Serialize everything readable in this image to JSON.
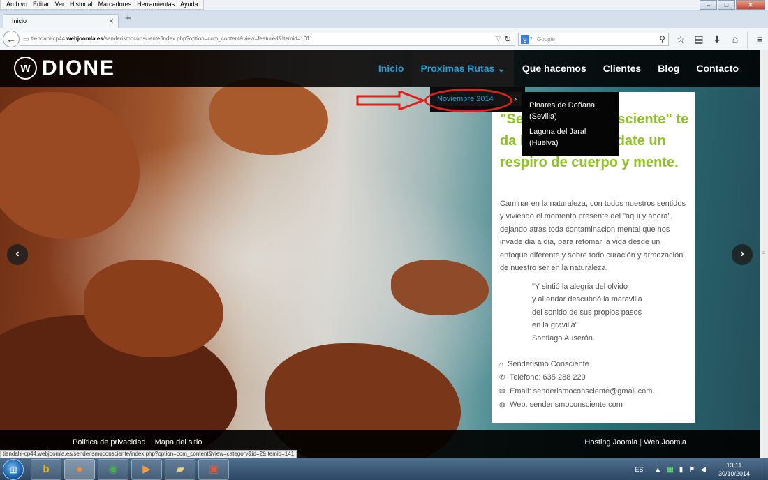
{
  "browser": {
    "menu": [
      "Archivo",
      "Editar",
      "Ver",
      "Historial",
      "Marcadores",
      "Herramientas",
      "Ayuda"
    ],
    "window_controls": {
      "minimize": "–",
      "maximize": "□",
      "close": "✕"
    },
    "tab": {
      "title": "Inicio",
      "close": "×"
    },
    "new_tab": "+",
    "url": {
      "prefix": "tiendahi-cp44.",
      "domain": "webjoomla.es",
      "path": "/senderismoconsciente/index.php?option=com_content&view=featured&Itemid=101"
    },
    "search": {
      "engine_badge": "g",
      "placeholder": "Google"
    },
    "status_url": "tiendahi-cp44.webjoomla.es/senderismoconsciente/index.php?option=com_content&view=category&id=2&Itemid=141"
  },
  "site": {
    "logo": {
      "mark": "w",
      "text": "DIONE"
    },
    "nav": [
      {
        "label": "Inicio"
      },
      {
        "label": "Proximas Rutas ⌄"
      },
      {
        "label": "Que hacemos"
      },
      {
        "label": "Clientes"
      },
      {
        "label": "Blog"
      },
      {
        "label": "Contacto"
      }
    ],
    "submenu": {
      "item": "Noviembre 2014",
      "caret": "›"
    },
    "subsubmenu": [
      {
        "line1": "Pinares de Doñana",
        "line2": "(Sevilla)"
      },
      {
        "line1": "Laguna del Jaral",
        "line2": "(Huelva)"
      }
    ],
    "panel": {
      "heading": "\"Senderismo Consciente\" te da la bienvenida, date un respiro de cuerpo y mente.",
      "intro": "Caminar en la naturaleza, con todos nuestros sentidos y viviendo el momento presente del \"aqui y ahora\", dejando atras toda contaminacion mental que nos invade dia a dia, para retomar la vida desde un enfoque diferente y sobre todo curación y armozación de nuestro ser en la naturaleza.",
      "quote": [
        "\"Y sintió la alegria del olvido",
        "y al andar descubrió la maravilla",
        "del sonido de sus propios pasos",
        "en la gravilla\"",
        "Santiago Auserón."
      ],
      "contact": {
        "name": "Senderismo Consciente",
        "phone": "Teléfono: 635 288 229",
        "email": "Email: senderismoconsciente@gmail.com.",
        "web": "Web: senderismoconsciente.com"
      }
    },
    "slider": {
      "prev": "‹",
      "next": "›"
    },
    "footer": {
      "links": [
        "Política de privacidad",
        "Mapa del sitio"
      ],
      "credit_a": "Hosting Joomla",
      "credit_sep": "|",
      "credit_b": "Web Joomla"
    }
  },
  "taskbar": {
    "language": "ES",
    "time": "13:11",
    "date": "30/10/2014"
  },
  "colors": {
    "accent_blue": "#1f9ed8",
    "heading_green": "#8fc31f",
    "annotation_red": "#e0201a"
  }
}
